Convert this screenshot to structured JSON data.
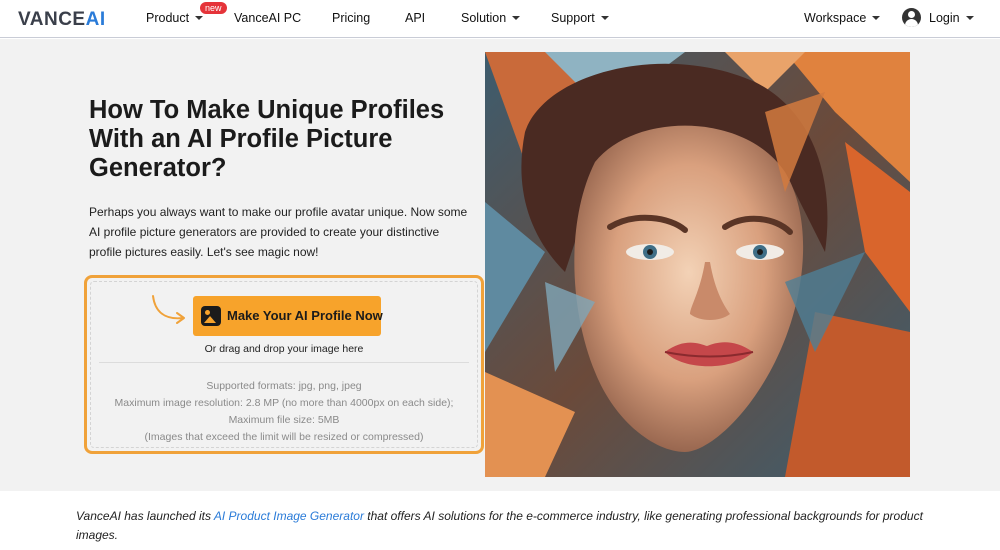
{
  "brand": {
    "name_part1": "VANCE",
    "name_part2": "AI"
  },
  "nav": {
    "product": "Product",
    "new_badge": "new",
    "vanceai_pc": "VanceAI PC",
    "pricing": "Pricing",
    "api": "API",
    "solution": "Solution",
    "support": "Support",
    "workspace": "Workspace",
    "login": "Login"
  },
  "hero": {
    "title": "How To Make Unique Profiles With an AI Profile Picture Generator?",
    "description": "Perhaps you always want to make our profile avatar unique. Now some AI profile picture generators are provided to create your distinctive profile pictures easily. Let's see magic now!",
    "upload": {
      "button_label": "Make Your AI Profile Now",
      "drag_text": "Or drag and drop your image here",
      "formats": "Supported formats: jpg, png, jpeg",
      "resolution": "Maximum image resolution: 2.8 MP (no more than 4000px on each side); Maximum file size: 5MB",
      "limit_note": "(Images that exceed the limit will be resized or compressed)"
    }
  },
  "announcement": {
    "prefix": "VanceAI has launched its ",
    "link_text": "AI Product Image Generator",
    "suffix": " that offers AI solutions for the e-commerce industry, like generating professional backgrounds for product images."
  },
  "colors": {
    "accent_orange": "#f7a32b",
    "upload_border": "#f0a23a",
    "link_blue": "#2a7bd8",
    "badge_red": "#e5343a"
  }
}
